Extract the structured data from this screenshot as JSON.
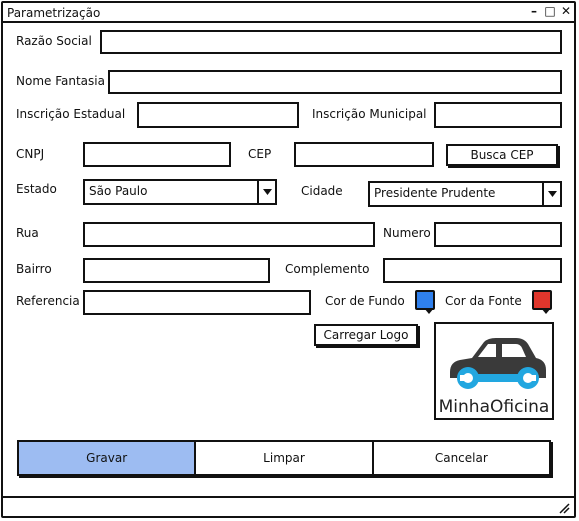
{
  "window": {
    "title": "Parametrização"
  },
  "fields": {
    "razao_social": {
      "label": "Razão Social",
      "value": ""
    },
    "nome_fantasia": {
      "label": "Nome Fantasia",
      "value": ""
    },
    "inscricao_estadual": {
      "label": "Inscrição Estadual",
      "value": ""
    },
    "inscricao_municipal": {
      "label": "Inscrição Municipal",
      "value": ""
    },
    "cnpj": {
      "label": "CNPJ",
      "value": ""
    },
    "cep": {
      "label": "CEP",
      "value": ""
    },
    "estado": {
      "label": "Estado",
      "value": "São Paulo"
    },
    "cidade": {
      "label": "Cidade",
      "value": "Presidente Prudente"
    },
    "rua": {
      "label": "Rua",
      "value": ""
    },
    "numero": {
      "label": "Numero",
      "value": ""
    },
    "bairro": {
      "label": "Bairro",
      "value": ""
    },
    "complemento": {
      "label": "Complemento",
      "value": ""
    },
    "referencia": {
      "label": "Referencia",
      "value": ""
    }
  },
  "colors": {
    "cor_de_fundo": {
      "label": "Cor de Fundo",
      "color": "#2f80ed"
    },
    "cor_da_fonte": {
      "label": "Cor da Fonte",
      "color": "#e0362c"
    }
  },
  "buttons": {
    "busca_cep": "Busca CEP",
    "carregar_logo": "Carregar Logo",
    "gravar": "Gravar",
    "limpar": "Limpar",
    "cancelar": "Cancelar"
  },
  "logo": {
    "text": "MinhaOficina",
    "car_color": "#3a3a3a",
    "wrench_color": "#22a7e0"
  },
  "accent": {
    "primary_button": "#9dbcf2"
  }
}
